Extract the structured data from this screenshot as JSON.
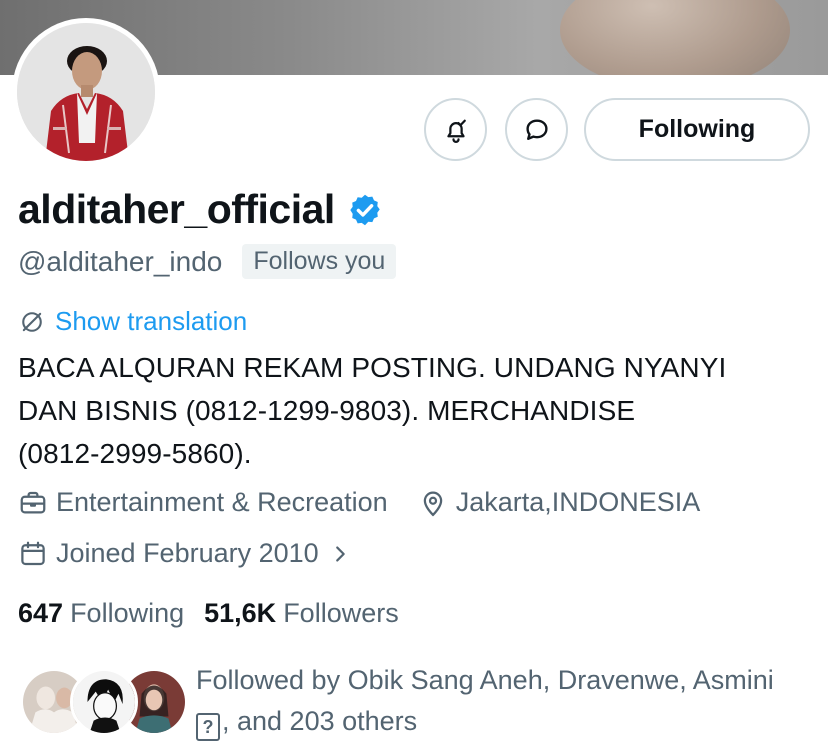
{
  "profile": {
    "display_name": "alditaher_official",
    "handle": "@alditaher_indo",
    "follows_you": "Follows you",
    "verified": true,
    "show_translation": "Show translation",
    "bio_lines": [
      "BACA ALQURAN REKAM POSTING. UNDANG NYANYI",
      "DAN BISNIS (0812-1299-9803). MERCHANDISE",
      "(0812-2999-5860)."
    ],
    "category": "Entertainment & Recreation",
    "location": "Jakarta,INDONESIA",
    "joined": "Joined February 2010"
  },
  "actions": {
    "following_button": "Following"
  },
  "stats": {
    "following_count": "647",
    "following_label": "Following",
    "followers_count": "51,6K",
    "followers_label": "Followers"
  },
  "followed_by": {
    "line1": "Followed by Obik Sang Aneh, Dravenwe, Asmini",
    "line2_box": "?",
    "line2_rest": ", and 203 others"
  },
  "icons": {
    "notification": "bell-check-icon",
    "message": "message-bubble-icon",
    "verified": "verified-badge-icon",
    "translate": "translate-icon",
    "category": "briefcase-icon",
    "location": "location-pin-icon",
    "joined": "calendar-icon",
    "chevron": "chevron-right-icon"
  },
  "colors": {
    "accent": "#1d9bf0",
    "secondary_text": "#536471",
    "primary_text": "#0f1419",
    "border": "#cfd9de",
    "badge_bg": "#eff3f4"
  }
}
